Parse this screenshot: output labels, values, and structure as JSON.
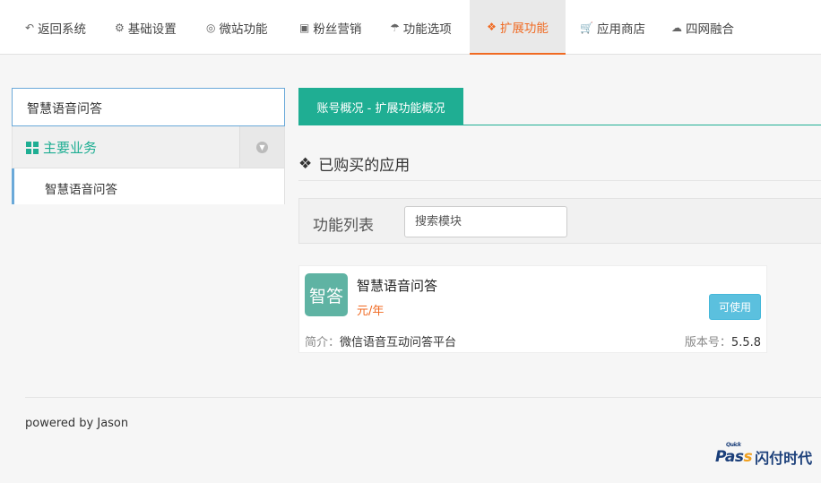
{
  "nav": {
    "items": [
      {
        "icon": "reply-icon",
        "glyph": "↶",
        "label": "返回系统"
      },
      {
        "icon": "gear-icon",
        "glyph": "⚙",
        "label": "基础设置"
      },
      {
        "icon": "lifebuoy-icon",
        "glyph": "◎",
        "label": "微站功能"
      },
      {
        "icon": "gift-icon",
        "glyph": "▣",
        "label": "粉丝营销"
      },
      {
        "icon": "umbrella-icon",
        "glyph": "☂",
        "label": "功能选项"
      },
      {
        "icon": "cubes-icon",
        "glyph": "❖",
        "label": "扩展功能"
      },
      {
        "icon": "cart-icon",
        "glyph": "🛒",
        "label": "应用商店"
      },
      {
        "icon": "cloud-download-icon",
        "glyph": "☁",
        "label": "四网融合"
      }
    ],
    "active_index": 5,
    "active_color": "#f06a22"
  },
  "sidebar": {
    "search_value": "智慧语音问答",
    "group_title": "主要业务",
    "group_icon": "grid-icon",
    "items": [
      "智慧语音问答"
    ]
  },
  "main": {
    "tab_label": "账号概况 - 扩展功能概况",
    "section_title": "已购买的应用",
    "section_icon": "cubes-icon",
    "function_list_label": "功能列表",
    "module_search_placeholder": "搜索模块"
  },
  "app": {
    "logo_text": "智答",
    "name": "智慧语音问答",
    "price": "元/年",
    "button_label": "可使用",
    "desc_label": "简介：",
    "desc": "微信语音互动问答平台",
    "version_label": "版本号：",
    "version": "5.5.8"
  },
  "footer": {
    "powered": "powered by Jason"
  },
  "brand": {
    "quick": "Quick",
    "pass_a": "Pas",
    "pass_s": "s",
    "cn": "闪付时代"
  },
  "colors": {
    "accent_green": "#1fae93",
    "accent_orange": "#f06a22",
    "info_blue": "#5bc0de"
  }
}
